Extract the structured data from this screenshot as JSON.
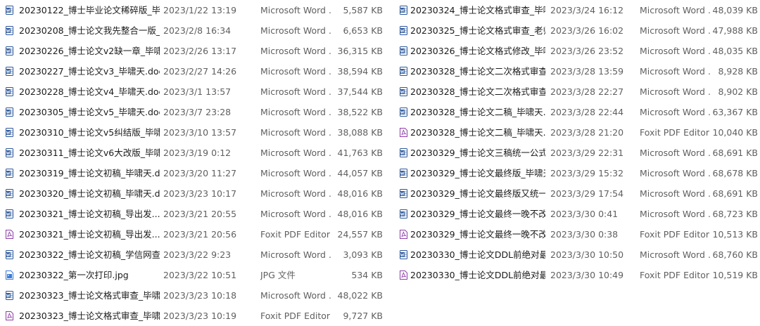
{
  "icons": {
    "word": {
      "name": "word-doc-icon",
      "color": "#2b579a"
    },
    "pdf": {
      "name": "pdf-doc-icon",
      "color": "#8e3fa8"
    },
    "jpg": {
      "name": "image-file-icon",
      "color": "#3a7bd5"
    }
  },
  "left_files": [
    {
      "kind": "word",
      "name": "20230122_博士毕业论文稀碎版_毕啸...",
      "date": "2023/1/22 13:19",
      "type": "Microsoft Word ...",
      "size": "5,587 KB"
    },
    {
      "kind": "word",
      "name": "20230208_博士论文我先整合一版_毕...",
      "date": "2023/2/8 16:34",
      "type": "Microsoft Word ...",
      "size": "6,653 KB"
    },
    {
      "kind": "word",
      "name": "20230226_博士论文v2缺一章_毕啸天...",
      "date": "2023/2/26 13:17",
      "type": "Microsoft Word ...",
      "size": "36,315 KB"
    },
    {
      "kind": "word",
      "name": "20230227_博士论文v3_毕啸天.docx",
      "date": "2023/2/27 14:26",
      "type": "Microsoft Word ...",
      "size": "38,594 KB"
    },
    {
      "kind": "word",
      "name": "20230228_博士论文v4_毕啸天.docx",
      "date": "2023/3/1 13:57",
      "type": "Microsoft Word ...",
      "size": "37,544 KB"
    },
    {
      "kind": "word",
      "name": "20230305_博士论文v5_毕啸天.docx",
      "date": "2023/3/7 23:28",
      "type": "Microsoft Word ...",
      "size": "38,522 KB"
    },
    {
      "kind": "word",
      "name": "20230310_博士论文v5纠结版_毕啸天...",
      "date": "2023/3/10 13:57",
      "type": "Microsoft Word ...",
      "size": "38,088 KB"
    },
    {
      "kind": "word",
      "name": "20230311_博士论文v6大改版_毕啸天...",
      "date": "2023/3/19 0:12",
      "type": "Microsoft Word ...",
      "size": "41,763 KB"
    },
    {
      "kind": "word",
      "name": "20230319_博士论文初稿_毕啸天.docx",
      "date": "2023/3/20 11:27",
      "type": "Microsoft Word ...",
      "size": "44,057 KB"
    },
    {
      "kind": "word",
      "name": "20230320_博士论文初稿_毕啸天.docx",
      "date": "2023/3/23 10:17",
      "type": "Microsoft Word ...",
      "size": "48,016 KB"
    },
    {
      "kind": "word",
      "name": "20230321_博士论文初稿_导出发...",
      "date": "2023/3/21 20:55",
      "type": "Microsoft Word ...",
      "size": "48,016 KB"
    },
    {
      "kind": "pdf",
      "name": "20230321_博士论文初稿_导出发...",
      "date": "2023/3/21 20:56",
      "type": "Foxit PDF Editor ...",
      "size": "24,557 KB"
    },
    {
      "kind": "word",
      "name": "20230322_博士论文初稿_学信网查重...",
      "date": "2023/3/22 9:23",
      "type": "Microsoft Word ...",
      "size": "3,093 KB"
    },
    {
      "kind": "jpg",
      "name": "20230322_第一次打印.jpg",
      "date": "2023/3/22 10:51",
      "type": "JPG 文件",
      "size": "534 KB"
    },
    {
      "kind": "word",
      "name": "20230323_博士论文格式审查_毕啸天...",
      "date": "2023/3/23 10:18",
      "type": "Microsoft Word ...",
      "size": "48,022 KB"
    },
    {
      "kind": "pdf",
      "name": "20230323_博士论文格式审查_毕啸天...",
      "date": "2023/3/23 10:19",
      "type": "Foxit PDF Editor ...",
      "size": "9,727 KB"
    }
  ],
  "right_files": [
    {
      "kind": "word",
      "name": "20230324_博士论文格式审查_毕啸天...",
      "date": "2023/3/24 16:12",
      "type": "Microsoft Word ...",
      "size": "48,039 KB"
    },
    {
      "kind": "word",
      "name": "20230325_博士论文格式审查_老师...",
      "date": "2023/3/26 16:02",
      "type": "Microsoft Word ...",
      "size": "47,988 KB"
    },
    {
      "kind": "word",
      "name": "20230326_博士论文格式修改_毕啸天...",
      "date": "2023/3/26 23:52",
      "type": "Microsoft Word ...",
      "size": "48,035 KB"
    },
    {
      "kind": "word",
      "name": "20230328_博士论文二次格式审查_毕...",
      "date": "2023/3/28 13:59",
      "type": "Microsoft Word ...",
      "size": "8,928 KB"
    },
    {
      "kind": "word",
      "name": "20230328_博士论文二次格式审查_...",
      "date": "2023/3/28 22:27",
      "type": "Microsoft Word ...",
      "size": "8,902 KB"
    },
    {
      "kind": "word",
      "name": "20230328_博士论文二稿_毕啸天.docx",
      "date": "2023/3/28 22:44",
      "type": "Microsoft Word ...",
      "size": "63,367 KB"
    },
    {
      "kind": "pdf",
      "name": "20230328_博士论文二稿_毕啸天.pdf",
      "date": "2023/3/28 21:20",
      "type": "Foxit PDF Editor ...",
      "size": "10,040 KB"
    },
    {
      "kind": "word",
      "name": "20230329_博士论文三稿统一公式_蒋...",
      "date": "2023/3/29 22:31",
      "type": "Microsoft Word ...",
      "size": "68,691 KB"
    },
    {
      "kind": "word",
      "name": "20230329_博士论文最终版_毕啸天.d...",
      "date": "2023/3/29 15:32",
      "type": "Microsoft Word ...",
      "size": "68,678 KB"
    },
    {
      "kind": "word",
      "name": "20230329_博士论文最终版又统一了...",
      "date": "2023/3/29 17:54",
      "type": "Microsoft Word ...",
      "size": "68,691 KB"
    },
    {
      "kind": "word",
      "name": "20230329_博士论文最终一晚不改版_...",
      "date": "2023/3/30 0:41",
      "type": "Microsoft Word ...",
      "size": "68,723 KB"
    },
    {
      "kind": "pdf",
      "name": "20230329_博士论文最终一晚不改版_...",
      "date": "2023/3/30 0:38",
      "type": "Foxit PDF Editor ...",
      "size": "10,513 KB"
    },
    {
      "kind": "word",
      "name": "20230330_博士论文DDL前绝对最终...",
      "date": "2023/3/30 10:50",
      "type": "Microsoft Word ...",
      "size": "68,760 KB"
    },
    {
      "kind": "pdf",
      "name": "20230330_博士论文DDL前绝对最终...",
      "date": "2023/3/30 10:49",
      "type": "Foxit PDF Editor ...",
      "size": "10,519 KB"
    }
  ]
}
